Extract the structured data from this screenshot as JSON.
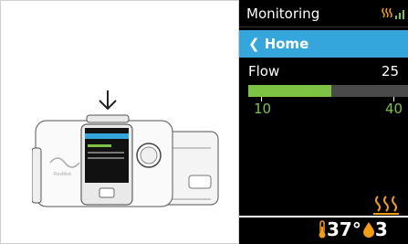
{
  "screen": {
    "title": "Monitoring",
    "nav_back": "Home",
    "metric_label": "Flow",
    "metric_value": "25",
    "bar_fill_fraction": 0.52,
    "bar_min_label": "10",
    "bar_max_label": "40",
    "temperature": "37°",
    "humidity_level": "3"
  },
  "colors": {
    "nav": "#35a6dc",
    "accent_green": "#7dc243",
    "humidity_orange": "#f39c12"
  },
  "illustration": {
    "device_brand": "ResMed"
  }
}
